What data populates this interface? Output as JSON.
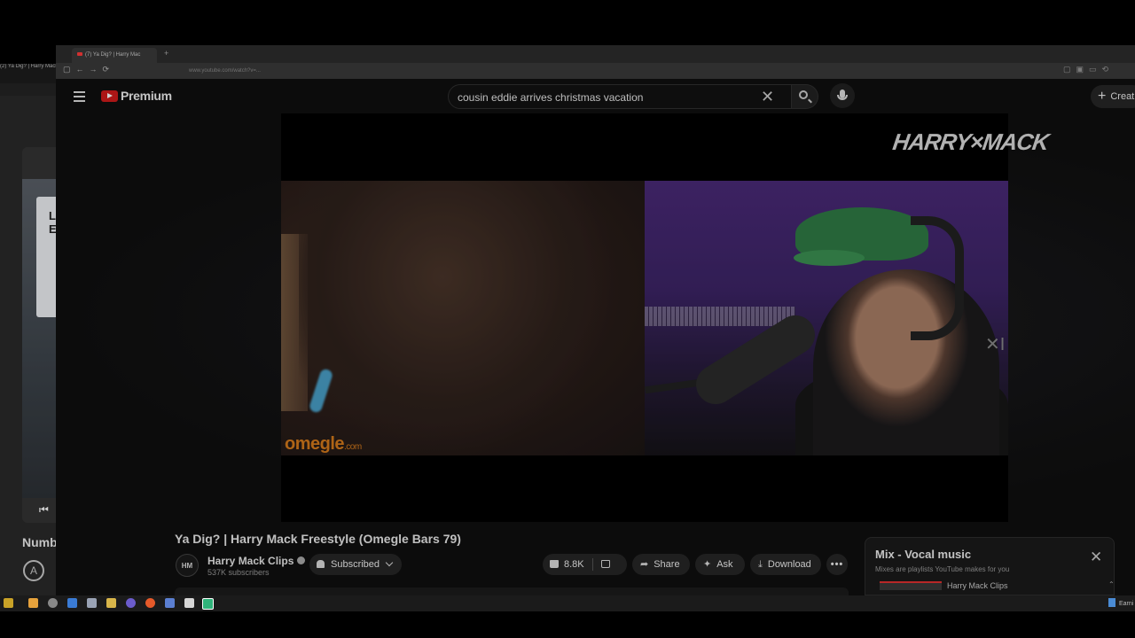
{
  "background_window": {
    "tab_text": "(2) Ya Dig? | Harry Mack",
    "numb_text": "Numb",
    "card_text": "L\nE"
  },
  "browser": {
    "tab_title": "(7) Ya Dig? | Harry Mac",
    "new_tab": "+",
    "url": "www.youtube.com/watch?v=..."
  },
  "youtube": {
    "brand": "Premium",
    "search_query": "cousin eddie arrives christmas vacation",
    "create_label": "Creat",
    "create_plus": "+"
  },
  "player": {
    "logo_text": "HARRY×MACK",
    "overlay_brand": "omegle",
    "overlay_brand_suffix": ".com"
  },
  "video": {
    "title": "Ya Dig? | Harry Mack Freestyle (Omegle Bars 79)",
    "channel_name": "Harry Mack Clips",
    "avatar_text": "HM",
    "subscribers": "537K subscribers",
    "subscribed_label": "Subscribed",
    "like_count": "8.8K",
    "share_label": "Share",
    "ask_label": "Ask",
    "download_label": "Download",
    "more_label": "•••"
  },
  "mix_panel": {
    "title": "Mix - Vocal music",
    "subtitle": "Mixes are playlists YouTube makes for you",
    "first_item_channel": "Harry Mack Clips",
    "close": "✕"
  },
  "taskbar": {
    "right_label": "Earni"
  },
  "colors": {
    "youtube_red": "#d11b1b",
    "omegle_orange": "#d57a1c",
    "purple_backdrop": "#4a2a78"
  }
}
